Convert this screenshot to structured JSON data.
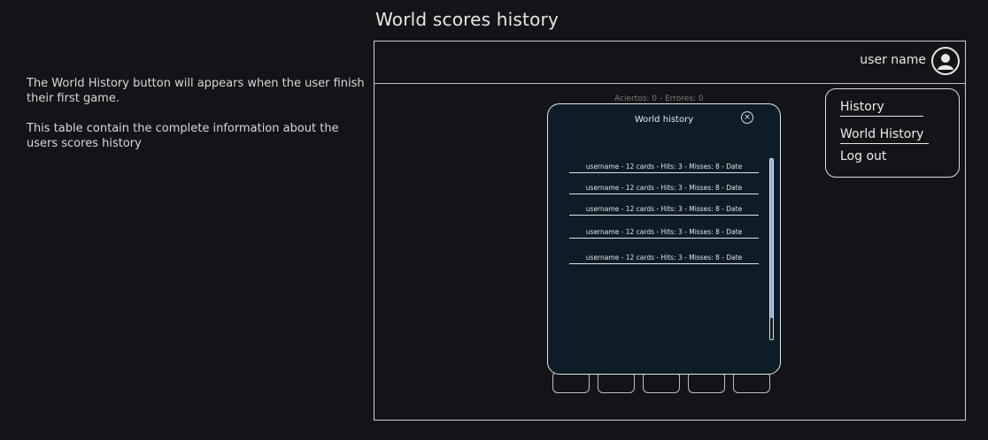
{
  "title": "World scores history",
  "notes": [
    "The World History button will appears when the user finish their first game.",
    "This table contain the complete information about the users scores history"
  ],
  "header": {
    "username": "user name",
    "avatar_icon": "user-avatar-icon"
  },
  "menu": {
    "items": [
      {
        "label": "History"
      },
      {
        "label": "World History"
      },
      {
        "label": "Log out"
      }
    ]
  },
  "background_score": "Aciertos: 0 - Errores: 0",
  "modal": {
    "title": "World history",
    "close_icon": "close-icon",
    "rows": [
      "username - 12 cards - Hits: 3 - Misses: 8 - Date",
      "username - 12 cards - Hits: 3 - Misses: 8 - Date",
      "username - 12 cards - Hits: 3 - Misses: 8 - Date",
      "username - 12 cards - Hits: 3 - Misses: 8 - Date",
      "username - 12 cards - Hits: 3 - Misses: 8 - Date"
    ]
  },
  "colors": {
    "background": "#121418",
    "modal_background": "#0d1d28",
    "scroll_thumb": "#7fb2dc",
    "line": "#e3e3e3"
  }
}
